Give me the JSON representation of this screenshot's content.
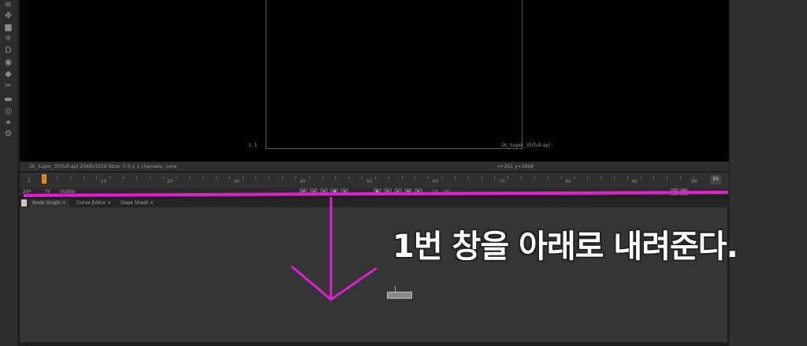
{
  "viewer": {
    "format_label": "2K_Super_35(full-ap)",
    "corner_label": "1, 1"
  },
  "infobar": {
    "left": "2K_Super_35(full-ap)  2048x1556  bbox: 0 0 1 1 channels: none",
    "coords": "x=201 y=1668"
  },
  "timeline": {
    "start_frame": "1",
    "end_frame": "99",
    "ticks": [
      "10",
      "20",
      "30",
      "40",
      "50",
      "60",
      "70",
      "80",
      "90",
      "99"
    ],
    "current_frame": "1"
  },
  "controls": {
    "fps": "24*",
    "tf": "TF",
    "visible": "Visible",
    "step_10": "10",
    "step_frames": "10"
  },
  "tabs": [
    {
      "label": "Node Graph"
    },
    {
      "label": "Curve Editor"
    },
    {
      "label": "Dope Sheet"
    }
  ],
  "annotation": {
    "caption": "1번 창을 아래로 내려준다.",
    "accent_color": "#e020d0"
  },
  "toolbar_icons": [
    "layers-icon",
    "move-icon",
    "cube-icon",
    "asterisk-icon",
    "d-icon",
    "eye-icon",
    "tag-icon",
    "wrench-icon",
    "film-icon",
    "gear-circle-icon",
    "star-icon",
    "settings-icon"
  ]
}
